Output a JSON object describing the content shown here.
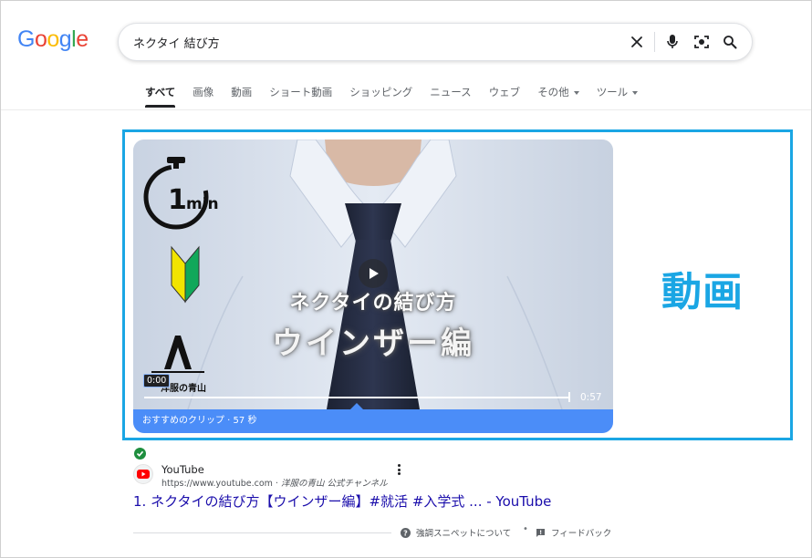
{
  "logo": {
    "text": "Google"
  },
  "search": {
    "query": "ネクタイ 結び方",
    "clear_icon": "close-icon",
    "mic_icon": "microphone-icon",
    "lens_icon": "camera-lens-icon",
    "search_icon": "search-icon"
  },
  "tabs": [
    {
      "label": "すべて",
      "active": true
    },
    {
      "label": "画像"
    },
    {
      "label": "動画"
    },
    {
      "label": "ショート動画"
    },
    {
      "label": "ショッピング"
    },
    {
      "label": "ニュース"
    },
    {
      "label": "ウェブ"
    },
    {
      "label": "その他",
      "dropdown": true
    },
    {
      "label": "ツール",
      "dropdown": true
    }
  ],
  "annotation": {
    "label": "動画",
    "color": "#1aa6e4"
  },
  "video": {
    "overlay_line1": "ネクタイの結び方",
    "overlay_line2": "ウインザー編",
    "timer_badge": "min",
    "timer_number": "1",
    "brand_logo_text": "洋服の青山",
    "current_time": "0:00",
    "duration": "0:57",
    "clip_label": "おすすめのクリップ · 57 秒",
    "clip_bar_color": "#4b8df8"
  },
  "result": {
    "site_name": "YouTube",
    "url": "https://www.youtube.com",
    "url_suffix": "洋服の青山 公式チャンネル",
    "title": "1. ネクタイの結び方【ウインザー編】#就活 #入学式 ... - YouTube",
    "verified_icon": "check-circle-icon"
  },
  "footer": {
    "snippet_label": "強調スニペットについて",
    "separator": "•",
    "feedback_label": "フィードバック"
  }
}
